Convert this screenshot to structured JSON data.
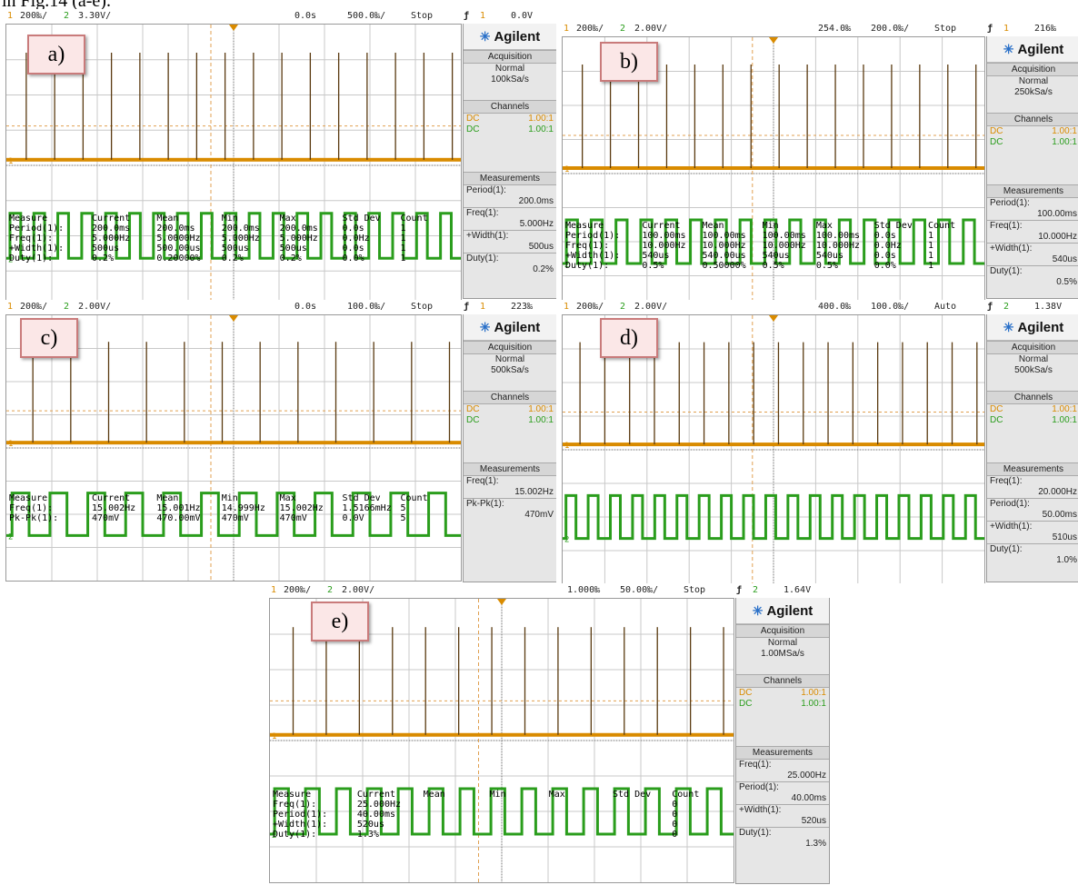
{
  "caption": "in Fig.14 (a-e).",
  "brand": "Agilent",
  "acq_label": "Acquisition",
  "chan_label": "Channels",
  "meas_label": "Measurements",
  "colors": {
    "ch1": "#d98b00",
    "ch2": "#2a9d1c",
    "grid": "#c8c8c8",
    "ref": "#e0a050"
  },
  "panels": {
    "a": {
      "tag": "a)",
      "top": {
        "ch1_num": "1",
        "ch1_scale": "200‰/",
        "ch2_num": "2",
        "ch2_scale": "3.30V/",
        "time": "0.0s",
        "tdiv": "500.0‰/",
        "mode": "Stop",
        "trig_ch": "1",
        "trig_lvl": "0.0V"
      },
      "acq_mode": "Normal",
      "acq_rate": "100kSa/s",
      "channels": [
        {
          "cpl": "DC",
          "ratio": "1.00:1"
        },
        {
          "cpl": "DC",
          "ratio": "1.00:1"
        }
      ],
      "meas": [
        {
          "label": "Period(1):",
          "value": "200.0ms"
        },
        {
          "label": "Freq(1):",
          "value": "5.000Hz"
        },
        {
          "label": "+Width(1):",
          "value": "500us"
        },
        {
          "label": "Duty(1):",
          "value": "0.2%"
        }
      ],
      "table": {
        "header": [
          "Measure",
          "Current",
          "Mean",
          "Min",
          "Max",
          "Std Dev",
          "Count"
        ],
        "rows": [
          [
            "Period(1):",
            "200.0ms",
            "200.0ms",
            "200.0ms",
            "200.0ms",
            "0.0s",
            "1"
          ],
          [
            "Freq(1):",
            "5.000Hz",
            "5.0000Hz",
            "5.000Hz",
            "5.000Hz",
            "0.0Hz",
            "1"
          ],
          [
            "+Width(1):",
            "500us",
            "500.00us",
            "500us",
            "500us",
            "0.0s",
            "1"
          ],
          [
            "Duty(1):",
            "0.2%",
            "0.20000%",
            "0.2%",
            "0.2%",
            "0.0%",
            "1"
          ]
        ]
      }
    },
    "b": {
      "tag": "b)",
      "top": {
        "ch1_num": "1",
        "ch1_scale": "200‰/",
        "ch2_num": "2",
        "ch2_scale": "2.00V/",
        "time": "254.0‰",
        "tdiv": "200.0‰/",
        "mode": "Stop",
        "trig_ch": "1",
        "trig_lvl": "216‰"
      },
      "acq_mode": "Normal",
      "acq_rate": "250kSa/s",
      "channels": [
        {
          "cpl": "DC",
          "ratio": "1.00:1"
        },
        {
          "cpl": "DC",
          "ratio": "1.00:1"
        }
      ],
      "meas": [
        {
          "label": "Period(1):",
          "value": "100.00ms"
        },
        {
          "label": "Freq(1):",
          "value": "10.000Hz"
        },
        {
          "label": "+Width(1):",
          "value": "540us"
        },
        {
          "label": "Duty(1):",
          "value": "0.5%"
        }
      ],
      "table": {
        "header": [
          "Measure",
          "Current",
          "Mean",
          "Min",
          "Max",
          "Std Dev",
          "Count"
        ],
        "rows": [
          [
            "Period(1):",
            "100.00ms",
            "100.00ms",
            "100.00ms",
            "100.00ms",
            "0.0s",
            "1"
          ],
          [
            "Freq(1):",
            "10.000Hz",
            "10.000Hz",
            "10.000Hz",
            "10.000Hz",
            "0.0Hz",
            "1"
          ],
          [
            "+Width(1):",
            "540us",
            "540.00us",
            "540us",
            "540us",
            "0.0s",
            "1"
          ],
          [
            "Duty(1):",
            "0.5%",
            "0.50000%",
            "0.5%",
            "0.5%",
            "0.0%",
            "1"
          ]
        ]
      }
    },
    "c": {
      "tag": "c)",
      "top": {
        "ch1_num": "1",
        "ch1_scale": "200‰/",
        "ch2_num": "2",
        "ch2_scale": "2.00V/",
        "time": "0.0s",
        "tdiv": "100.0‰/",
        "mode": "Stop",
        "trig_ch": "1",
        "trig_lvl": "223‰"
      },
      "acq_mode": "Normal",
      "acq_rate": "500kSa/s",
      "channels": [
        {
          "cpl": "DC",
          "ratio": "1.00:1"
        },
        {
          "cpl": "DC",
          "ratio": "1.00:1"
        }
      ],
      "meas": [
        {
          "label": "Freq(1):",
          "value": "15.002Hz"
        },
        {
          "label": "Pk-Pk(1):",
          "value": "470mV"
        }
      ],
      "table": {
        "header": [
          "Measure",
          "Current",
          "Mean",
          "Min",
          "Max",
          "Std Dev",
          "Count"
        ],
        "rows": [
          [
            "Freq(1):",
            "15.002Hz",
            "15.001Hz",
            "14.999Hz",
            "15.002Hz",
            "1.5166mHz",
            "5"
          ],
          [
            "Pk-Pk(1):",
            "470mV",
            "470.00mV",
            "470mV",
            "470mV",
            "0.0V",
            "5"
          ]
        ]
      }
    },
    "d": {
      "tag": "d)",
      "top": {
        "ch1_num": "1",
        "ch1_scale": "200‰/",
        "ch2_num": "2",
        "ch2_scale": "2.00V/",
        "time": "400.0‰",
        "tdiv": "100.0‰/",
        "mode": "Auto",
        "trig_ch": "2",
        "trig_lvl": "1.38V"
      },
      "acq_mode": "Normal",
      "acq_rate": "500kSa/s",
      "channels": [
        {
          "cpl": "DC",
          "ratio": "1.00:1"
        },
        {
          "cpl": "DC",
          "ratio": "1.00:1"
        }
      ],
      "meas": [
        {
          "label": "Freq(1):",
          "value": "20.000Hz"
        },
        {
          "label": "Period(1):",
          "value": "50.00ms"
        },
        {
          "label": "+Width(1):",
          "value": "510us"
        },
        {
          "label": "Duty(1):",
          "value": "1.0%"
        }
      ],
      "table": {
        "header": [],
        "rows": []
      }
    },
    "e": {
      "tag": "e)",
      "top": {
        "ch1_num": "1",
        "ch1_scale": "200‰/",
        "ch2_num": "2",
        "ch2_scale": "2.00V/",
        "time": "1.000‰",
        "tdiv": "50.00‰/",
        "mode": "Stop",
        "trig_ch": "2",
        "trig_lvl": "1.64V"
      },
      "acq_mode": "Normal",
      "acq_rate": "1.00MSa/s",
      "channels": [
        {
          "cpl": "DC",
          "ratio": "1.00:1"
        },
        {
          "cpl": "DC",
          "ratio": "1.00:1"
        }
      ],
      "meas": [
        {
          "label": "Freq(1):",
          "value": "25.000Hz"
        },
        {
          "label": "Period(1):",
          "value": "40.00ms"
        },
        {
          "label": "+Width(1):",
          "value": "520us"
        },
        {
          "label": "Duty(1):",
          "value": "1.3%"
        }
      ],
      "table": {
        "header": [
          "Measure",
          "Current",
          "Mean",
          "Min",
          "Max",
          "Std Dev",
          "Count"
        ],
        "rows": [
          [
            "Freq(1):",
            "25.000Hz",
            "",
            "",
            "",
            "",
            "0"
          ],
          [
            "Period(1):",
            "40.00ms",
            "",
            "",
            "",
            "",
            "0"
          ],
          [
            "+Width(1):",
            "520us",
            "",
            "",
            "",
            "",
            "0"
          ],
          [
            "Duty(1):",
            "1.3%",
            "",
            "",
            "",
            "",
            "0"
          ]
        ]
      }
    }
  }
}
